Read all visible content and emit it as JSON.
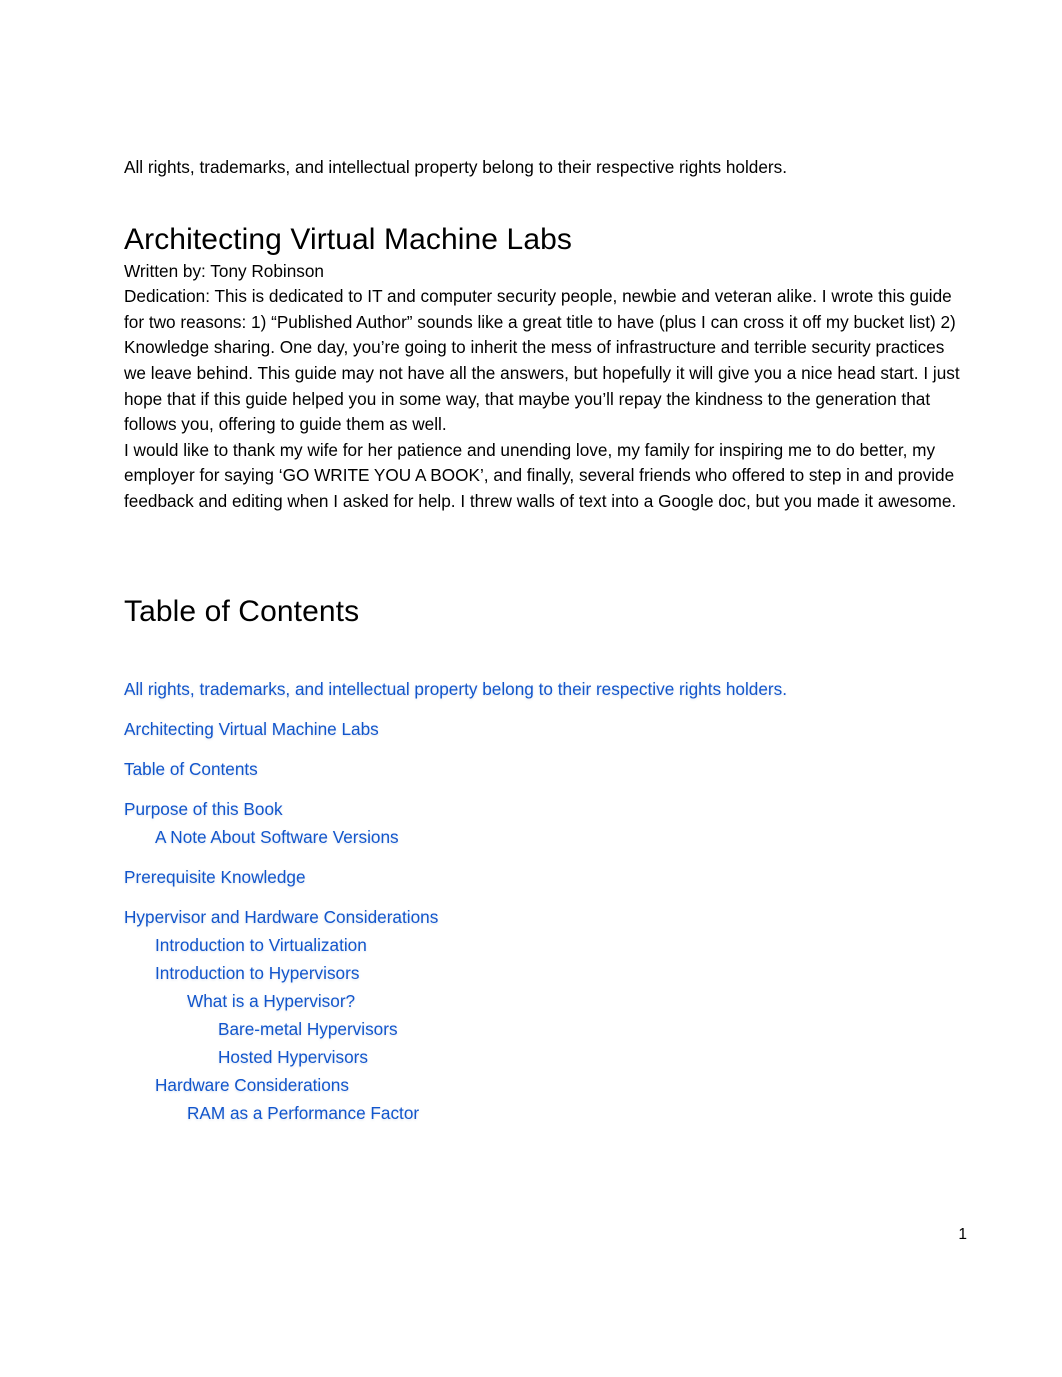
{
  "document": {
    "rights_notice": "All rights, trademarks, and intellectual property belong to their respective rights holders.",
    "title": "Architecting Virtual Machine Labs",
    "author_line": "Written by: Tony Robinson",
    "dedication": "Dedication: This is dedicated to IT and computer security people, newbie and veteran alike. I wrote this guide for two reasons: 1) “Published Author” sounds like a great title to have (plus I can cross it off my bucket list) 2) Knowledge sharing. One day, you’re going to inherit the mess of infrastructure and terrible security practices we leave behind. This guide may not have all the answers, but hopefully it will give you a nice head start. I just hope that if this guide helped you in some way, that maybe you’ll repay the kindness to the generation that follows you, offering to guide them as well.",
    "acknowledgements": "I would like to thank my wife for her patience and unending love, my family for inspiring me to do better, my employer for saying ‘GO WRITE YOU A BOOK’, and finally, several friends who offered to step in and provide feedback and editing when I asked for help. I threw walls of text into a Google doc, but you made it awesome.",
    "page_number": "1"
  },
  "table_of_contents": {
    "heading": "Table of Contents",
    "link_color": "#1155cc",
    "entries": [
      {
        "label": "All rights, trademarks, and intellectual property belong to their respective rights holders.",
        "level": 1,
        "spacing": "gap"
      },
      {
        "label": "Architecting Virtual Machine Labs",
        "level": 1,
        "spacing": "gap"
      },
      {
        "label": "Table of Contents",
        "level": 1,
        "spacing": "gap"
      },
      {
        "label": "Purpose of this Book",
        "level": 1,
        "spacing": "gap"
      },
      {
        "label": "A Note About Software Versions",
        "level": 2,
        "spacing": "tight"
      },
      {
        "label": "Prerequisite Knowledge",
        "level": 1,
        "spacing": "gap"
      },
      {
        "label": "Hypervisor and Hardware Considerations",
        "level": 1,
        "spacing": "gap"
      },
      {
        "label": "Introduction to Virtualization",
        "level": 2,
        "spacing": "tight"
      },
      {
        "label": "Introduction to Hypervisors",
        "level": 2,
        "spacing": "tight"
      },
      {
        "label": "What is a Hypervisor?",
        "level": 3,
        "spacing": "tight"
      },
      {
        "label": "Bare-metal Hypervisors",
        "level": 4,
        "spacing": "tight"
      },
      {
        "label": "Hosted Hypervisors",
        "level": 4,
        "spacing": "tight"
      },
      {
        "label": "Hardware Considerations",
        "level": 2,
        "spacing": "tight"
      },
      {
        "label": "RAM as a Performance Factor",
        "level": 3,
        "spacing": "tight"
      }
    ]
  }
}
